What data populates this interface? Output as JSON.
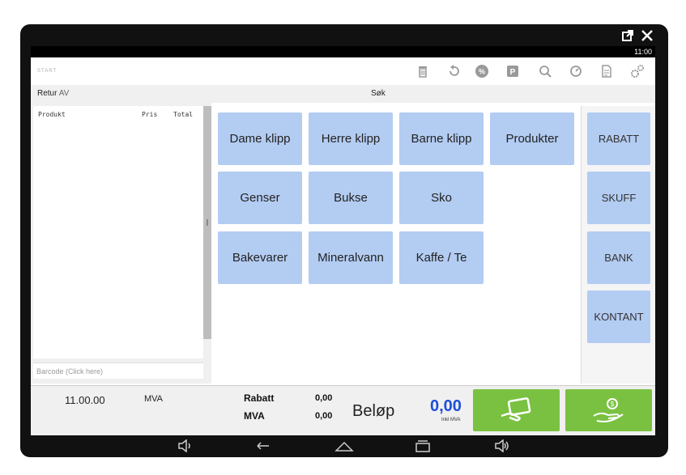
{
  "statusbar": {
    "time": "11:00"
  },
  "topbar": {
    "start_label": "START",
    "icons": [
      "trash-icon",
      "undo-icon",
      "percent-icon",
      "parking-icon",
      "search-icon",
      "refresh-icon",
      "document-icon",
      "gears-icon"
    ]
  },
  "searchrow": {
    "retur": "Retur",
    "av": "AV",
    "search_label": "Søk"
  },
  "receipt": {
    "col_product": "Produkt",
    "col_price": "Pris",
    "col_total": "Total",
    "barcode_placeholder": "Barcode (Click here)"
  },
  "categories": [
    "Dame klipp",
    "Herre klipp",
    "Barne klipp",
    "Produkter",
    "Genser",
    "Bukse",
    "Sko",
    "Bakevarer",
    "Mineralvann",
    "Kaffe / Te"
  ],
  "actions": [
    "RABATT",
    "SKUFF",
    "BANK",
    "KONTANT"
  ],
  "footer": {
    "time": "11.00.00",
    "mva_label": "MVA",
    "rabatt_label": "Rabatt",
    "rabatt_value": "0,00",
    "mva_sum_label": "MVA",
    "mva_sum_value": "0,00",
    "belop_label": "Beløp",
    "amount": "0,00",
    "inkl_label": "Inkl MVA"
  },
  "colors": {
    "button": "#b3ccf2",
    "pay_green": "#7ac142",
    "amount_blue": "#1d4fd8"
  }
}
